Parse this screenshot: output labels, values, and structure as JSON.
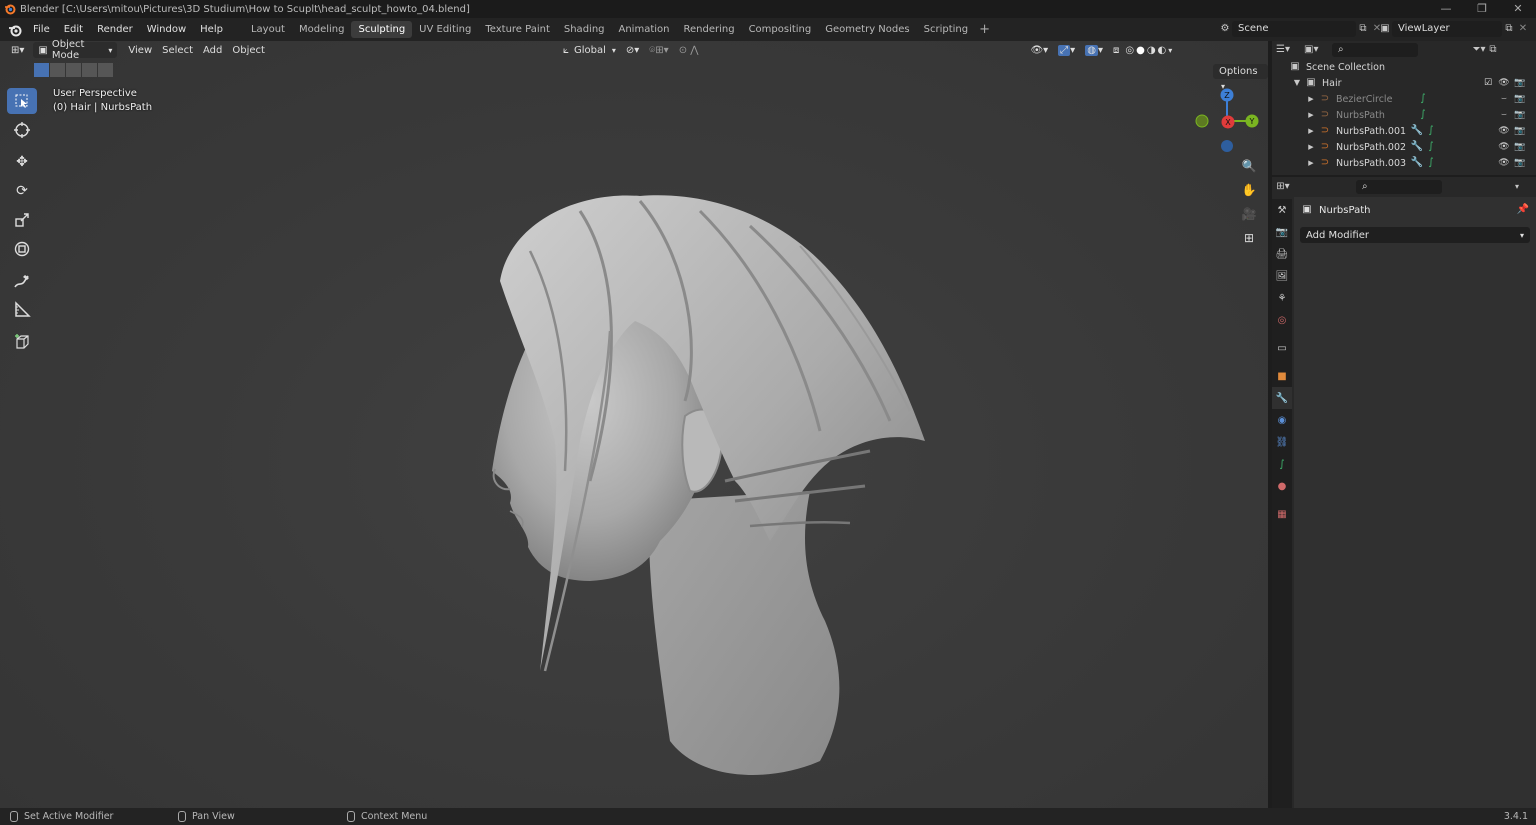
{
  "window": {
    "title": "Blender [C:\\Users\\mitou\\Pictures\\3D Studium\\How to Scuplt\\head_sculpt_howto_04.blend]",
    "controls": [
      "—",
      "❐",
      "✕"
    ]
  },
  "menu": [
    "File",
    "Edit",
    "Render",
    "Window",
    "Help"
  ],
  "workspaces": {
    "tabs": [
      "Layout",
      "Modeling",
      "Sculpting",
      "UV Editing",
      "Texture Paint",
      "Shading",
      "Animation",
      "Rendering",
      "Compositing",
      "Geometry Nodes",
      "Scripting"
    ],
    "active": "Sculpting",
    "add": "+"
  },
  "scene": {
    "label": "Scene"
  },
  "viewlayer": {
    "label": "ViewLayer"
  },
  "viewport": {
    "mode": "Object Mode",
    "menus": [
      "View",
      "Select",
      "Add",
      "Object"
    ],
    "orientation": "Global",
    "options": "Options",
    "info_line1": "User Perspective",
    "info_line2": "(0) Hair | NurbsPath",
    "gizmo": {
      "z": "Z",
      "y": "Y",
      "x": "X"
    }
  },
  "outliner": {
    "root": "Scene Collection",
    "collection": "Hair",
    "items": [
      {
        "name": "BezierCircle",
        "dim": true,
        "modifier": false
      },
      {
        "name": "NurbsPath",
        "dim": true,
        "modifier": false
      },
      {
        "name": "NurbsPath.001",
        "dim": false,
        "modifier": true
      },
      {
        "name": "NurbsPath.002",
        "dim": false,
        "modifier": true
      },
      {
        "name": "NurbsPath.003",
        "dim": false,
        "modifier": true
      }
    ]
  },
  "properties": {
    "object_name": "NurbsPath",
    "add_modifier": "Add Modifier"
  },
  "statusbar": {
    "left": "Set Active Modifier",
    "middle": "Pan View",
    "right": "Context Menu",
    "version": "3.4.1"
  },
  "colors": {
    "accent": "#4772b3",
    "gizmo_x": "#e03b3b",
    "gizmo_y": "#7ab521",
    "gizmo_z": "#3d7fd6",
    "curve_orange": "#d1732b",
    "modifier_blue": "#5b8fd6",
    "curve_green": "#3fb56e"
  }
}
